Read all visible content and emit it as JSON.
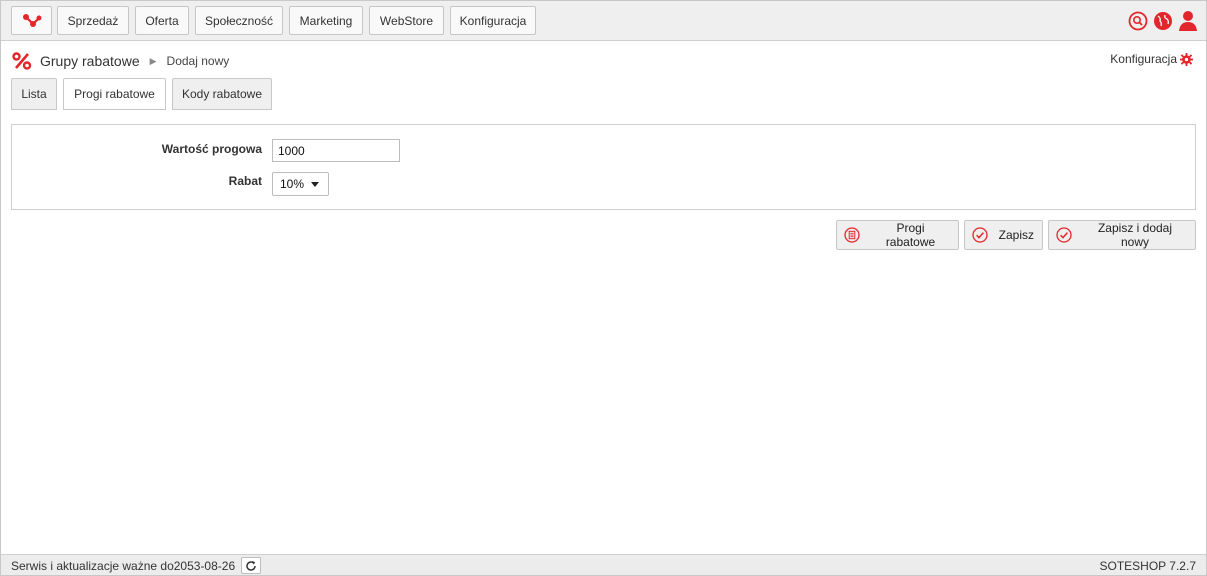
{
  "nav": {
    "logo": "soteshop-logo-icon",
    "items": [
      {
        "label": "Sprzedaż"
      },
      {
        "label": "Oferta"
      },
      {
        "label": "Społeczność"
      },
      {
        "label": "Marketing"
      },
      {
        "label": "WebStore"
      },
      {
        "label": "Konfiguracja"
      }
    ],
    "icons": [
      "search-icon",
      "globe-icon",
      "user-icon"
    ]
  },
  "breadcrumb": {
    "title": "Grupy rabatowe",
    "current": "Dodaj nowy",
    "config_label": "Konfiguracja"
  },
  "tabs": [
    {
      "label": "Lista",
      "active": false
    },
    {
      "label": "Progi rabatowe",
      "active": true
    },
    {
      "label": "Kody rabatowe",
      "active": false
    }
  ],
  "form": {
    "threshold_label": "Wartość progowa",
    "threshold_value": "1000",
    "discount_label": "Rabat",
    "discount_selected": "10%"
  },
  "actions": [
    {
      "label": "Progi rabatowe",
      "icon": "list-icon"
    },
    {
      "label": "Zapisz",
      "icon": "check-icon"
    },
    {
      "label": "Zapisz i dodaj nowy",
      "icon": "check-icon"
    }
  ],
  "footer": {
    "service_text": "Serwis i aktualizacje ważne do2053-08-26",
    "version": "SOTESHOP 7.2.7"
  },
  "colors": {
    "accent": "#e3262b",
    "nav_bg": "#efefef",
    "border": "#c6c6c6"
  }
}
